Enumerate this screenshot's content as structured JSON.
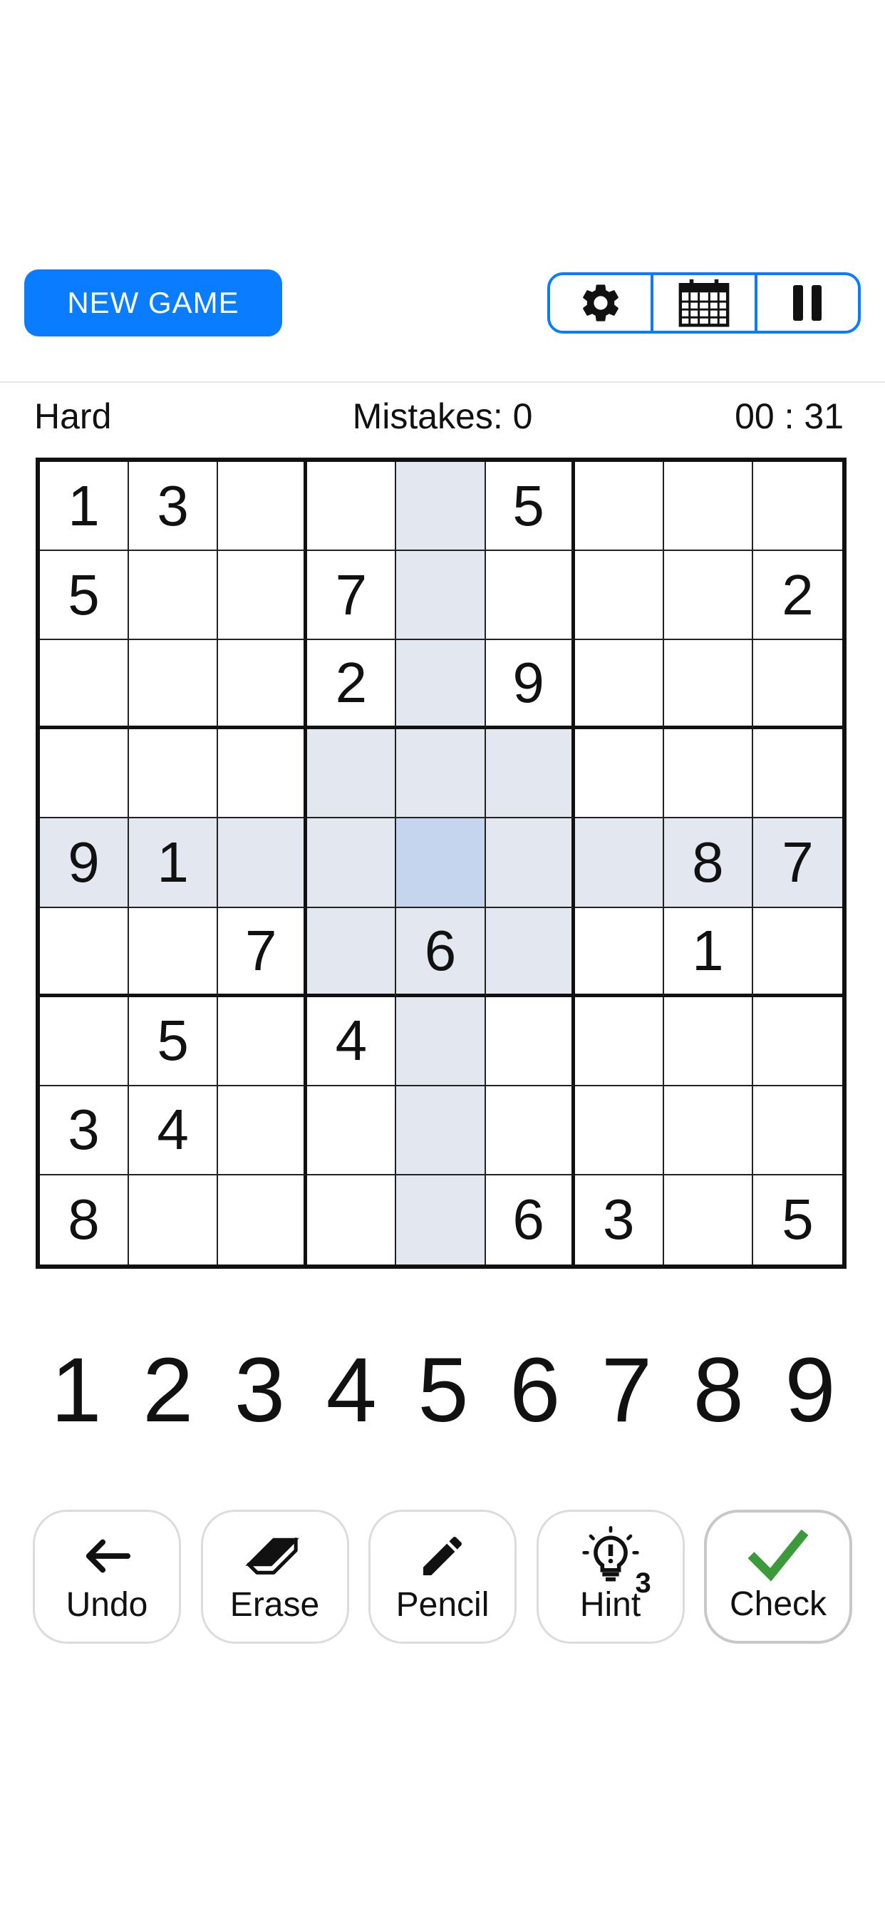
{
  "header": {
    "new_game_label": "NEW GAME",
    "tools": [
      {
        "icon": "gear-icon"
      },
      {
        "icon": "calendar-icon"
      },
      {
        "icon": "pause-icon"
      }
    ]
  },
  "status": {
    "difficulty": "Hard",
    "mistakes": "Mistakes: 0",
    "timer": "00 : 31"
  },
  "board": {
    "rows": [
      [
        "1",
        "3",
        "",
        "",
        "",
        "5",
        "",
        "",
        ""
      ],
      [
        "5",
        "",
        "",
        "7",
        "",
        "",
        "",
        "",
        "2"
      ],
      [
        "",
        "",
        "",
        "2",
        "",
        "9",
        "",
        "",
        ""
      ],
      [
        "",
        "",
        "",
        "",
        "",
        "",
        "",
        "",
        ""
      ],
      [
        "9",
        "1",
        "",
        "",
        "",
        "",
        "",
        "8",
        "7"
      ],
      [
        "",
        "",
        "7",
        "",
        "6",
        "",
        "",
        "1",
        ""
      ],
      [
        "",
        "5",
        "",
        "4",
        "",
        "",
        "",
        "",
        ""
      ],
      [
        "3",
        "4",
        "",
        "",
        "",
        "",
        "",
        "",
        ""
      ],
      [
        "8",
        "",
        "",
        "",
        "",
        "6",
        "3",
        "",
        "5"
      ]
    ],
    "selected_cell": {
      "row": 5,
      "col": 5
    },
    "highlight_color": "#e3e7f0",
    "selected_color": "#c6d5ee"
  },
  "numpad": [
    "1",
    "2",
    "3",
    "4",
    "5",
    "6",
    "7",
    "8",
    "9"
  ],
  "actions": [
    {
      "id": "undo",
      "label": "Undo",
      "icon": "arrow-left-icon"
    },
    {
      "id": "erase",
      "label": "Erase",
      "icon": "eraser-icon"
    },
    {
      "id": "pencil",
      "label": "Pencil",
      "icon": "pencil-icon"
    },
    {
      "id": "hint",
      "label": "Hint",
      "icon": "lightbulb-icon",
      "count": "3"
    },
    {
      "id": "check",
      "label": "Check",
      "icon": "checkmark-icon"
    }
  ],
  "colors": {
    "accent": "#0a7cff",
    "check": "#3d9a3a"
  }
}
